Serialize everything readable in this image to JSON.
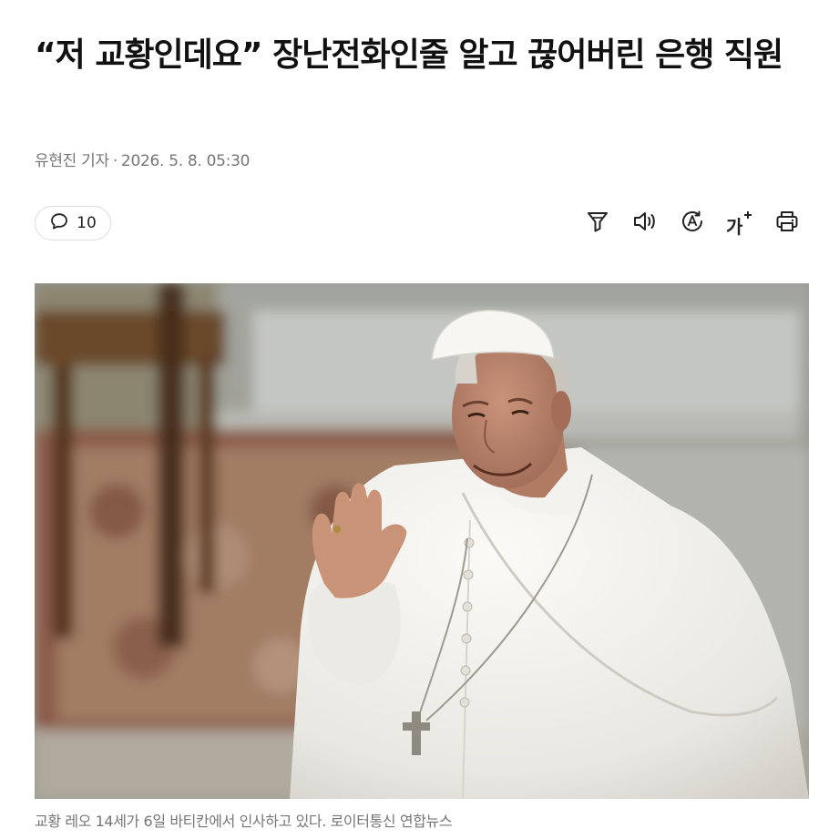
{
  "article": {
    "headline": "“저 교황인데요” 장난전화인줄 알고 끊어버린 은행 직원",
    "reporter": "유현진 기자",
    "separator": "·",
    "date": "2026. 5. 8. 05:30"
  },
  "toolbar": {
    "comment_count": "10",
    "font_size_label": "가",
    "icons": [
      "comment-icon",
      "summary-filter-icon",
      "speaker-icon",
      "translate-icon",
      "font-size-icon",
      "print-icon"
    ]
  },
  "photo": {
    "caption": "교황 레오 14세가 6일 바티칸에서 인사하고 있다. 로이터통신 연합뉴스"
  },
  "colors": {
    "text": "#111111",
    "meta": "#767676",
    "border": "#dcdcdc"
  }
}
